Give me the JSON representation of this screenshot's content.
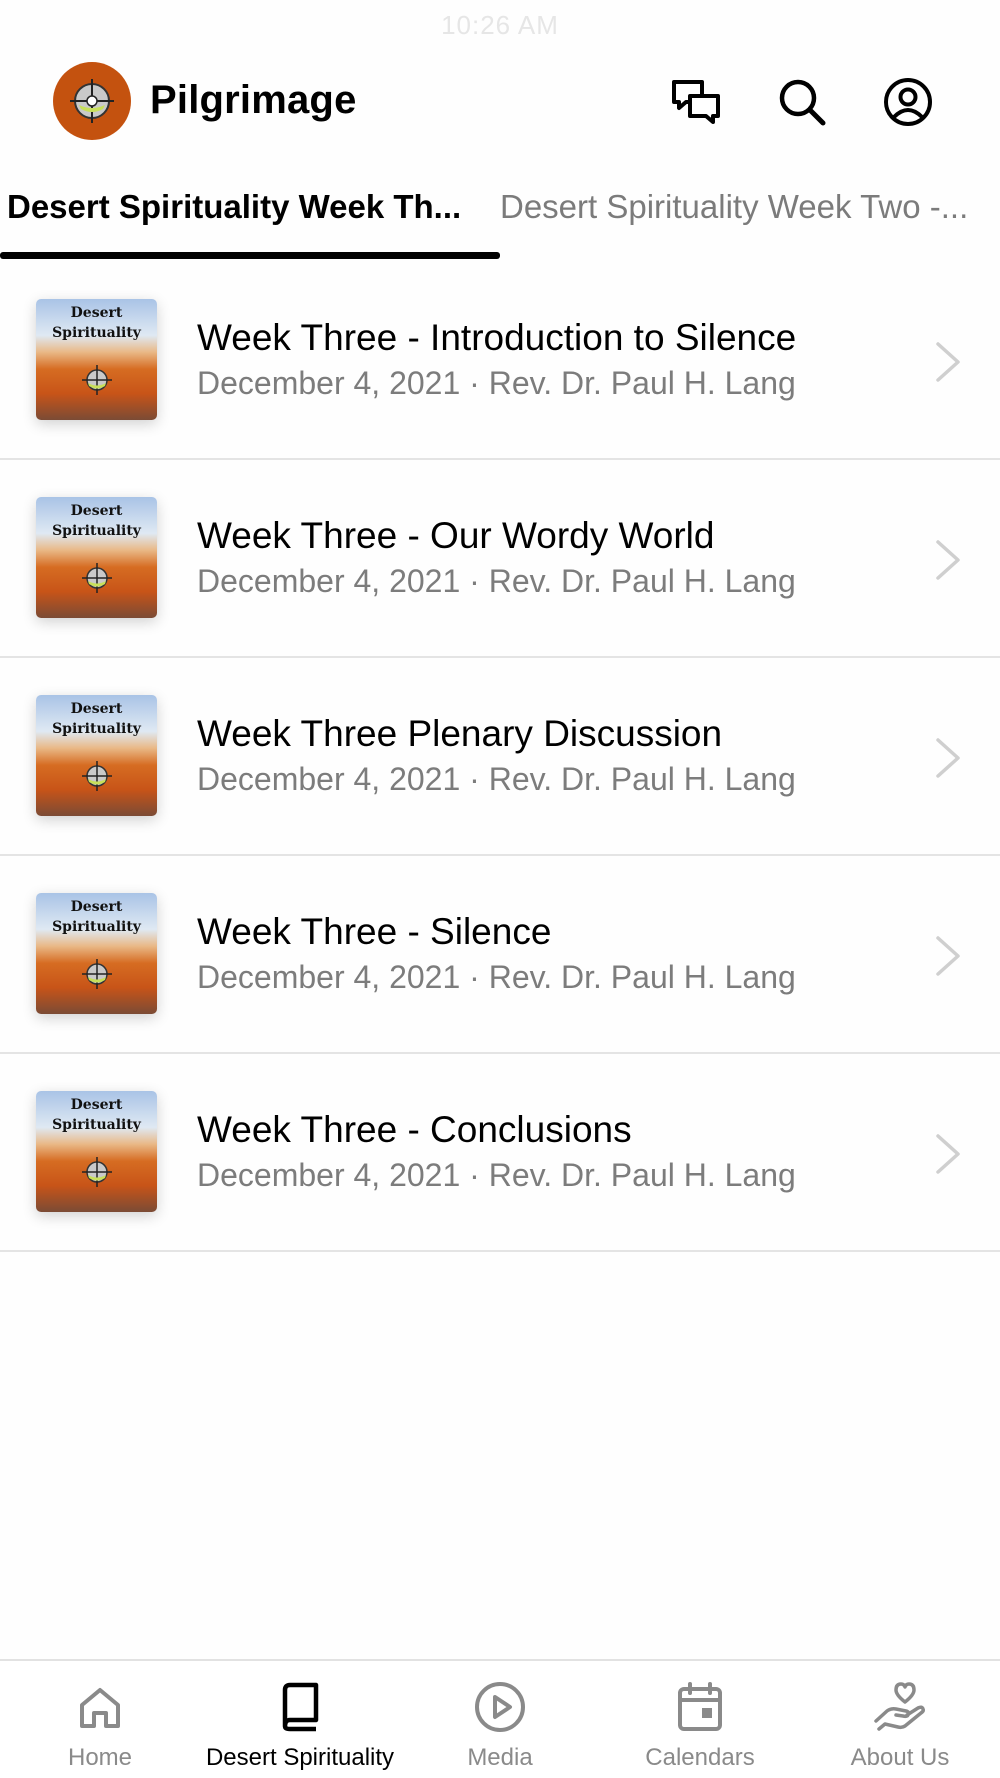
{
  "status_bar": {
    "time": "10:26 AM"
  },
  "header": {
    "title": "Pilgrimage",
    "logo_icon": "pilgrimage-compass-logo",
    "actions": [
      {
        "icon": "chat-icon"
      },
      {
        "icon": "search-icon"
      },
      {
        "icon": "account-icon"
      }
    ]
  },
  "tabs": [
    {
      "label": "Desert Spirituality Week Th...",
      "active": true
    },
    {
      "label": "Desert Spirituality Week Two -...",
      "active": false
    }
  ],
  "thumbnail": {
    "line1": "Desert",
    "line2": "Spirituality"
  },
  "items": [
    {
      "title": "Week Three - Introduction to Silence",
      "meta": "December 4, 2021 · Rev. Dr. Paul H. Lang"
    },
    {
      "title": "Week Three - Our Wordy World",
      "meta": "December 4, 2021 · Rev. Dr. Paul H. Lang"
    },
    {
      "title": "Week Three Plenary Discussion",
      "meta": "December 4, 2021 · Rev. Dr. Paul H. Lang"
    },
    {
      "title": "Week Three - Silence",
      "meta": "December 4, 2021 · Rev. Dr. Paul H. Lang"
    },
    {
      "title": "Week Three - Conclusions",
      "meta": "December 4, 2021 · Rev. Dr. Paul H. Lang"
    }
  ],
  "bottom_nav": [
    {
      "label": "Home",
      "icon": "home-icon",
      "active": false
    },
    {
      "label": "Desert Spirituality",
      "icon": "book-icon",
      "active": true
    },
    {
      "label": "Media",
      "icon": "play-icon",
      "active": false
    },
    {
      "label": "Calendars",
      "icon": "calendar-icon",
      "active": false
    },
    {
      "label": "About Us",
      "icon": "heart-hand-icon",
      "active": false
    }
  ],
  "colors": {
    "accent": "#000000",
    "logo_background": "#c4520f",
    "muted_text": "#7c7c7c",
    "inactive_nav": "#8a8a8a",
    "divider": "#e4e4e4"
  }
}
